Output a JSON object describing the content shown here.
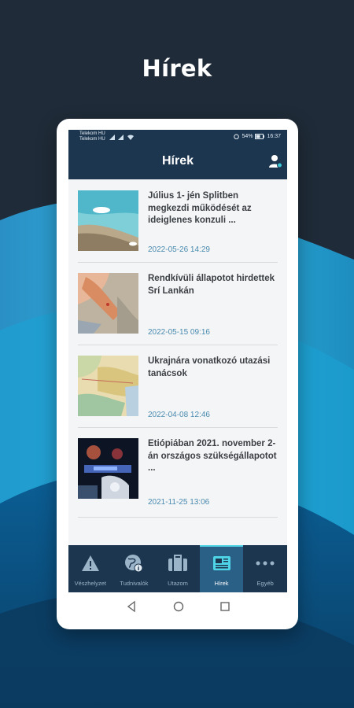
{
  "promo": {
    "title": "Hírek"
  },
  "status_bar": {
    "carrier1": "Telekom HU",
    "carrier2": "Telekom HU",
    "battery": "54%",
    "time": "16:37"
  },
  "app_bar": {
    "title": "Hírek",
    "profile_icon": "user-icon"
  },
  "news": [
    {
      "title": "Július 1- jén Splitben megkezdi működését az ideiglenes konzuli ...",
      "date": "2022-05-26 14:29",
      "thumb": "coast-boat"
    },
    {
      "title": "Rendkívüli állapotot hirdettek Srí Lankán",
      "date": "2022-05-15 09:16",
      "thumb": "map-srilanka"
    },
    {
      "title": "Ukrajnára vonatkozó utazási tanácsok",
      "date": "2022-04-08 12:46",
      "thumb": "map-ukraine"
    },
    {
      "title": "Etiópiában 2021. november 2-án országos szükségállapotot ...",
      "date": "2021-11-25 13:06",
      "thumb": "police-night"
    }
  ],
  "tabs": [
    {
      "label": "Vészhelyzet",
      "icon": "warning-icon",
      "active": false
    },
    {
      "label": "Tudnivalók",
      "icon": "globe-info-icon",
      "active": false
    },
    {
      "label": "Utazom",
      "icon": "suitcase-icon",
      "active": false
    },
    {
      "label": "Hírek",
      "icon": "newspaper-icon",
      "active": true
    },
    {
      "label": "Egyéb",
      "icon": "more-icon",
      "active": false
    }
  ],
  "colors": {
    "primary": "#1c3650",
    "accent": "#4fd3e6",
    "date": "#4a8bb0"
  }
}
